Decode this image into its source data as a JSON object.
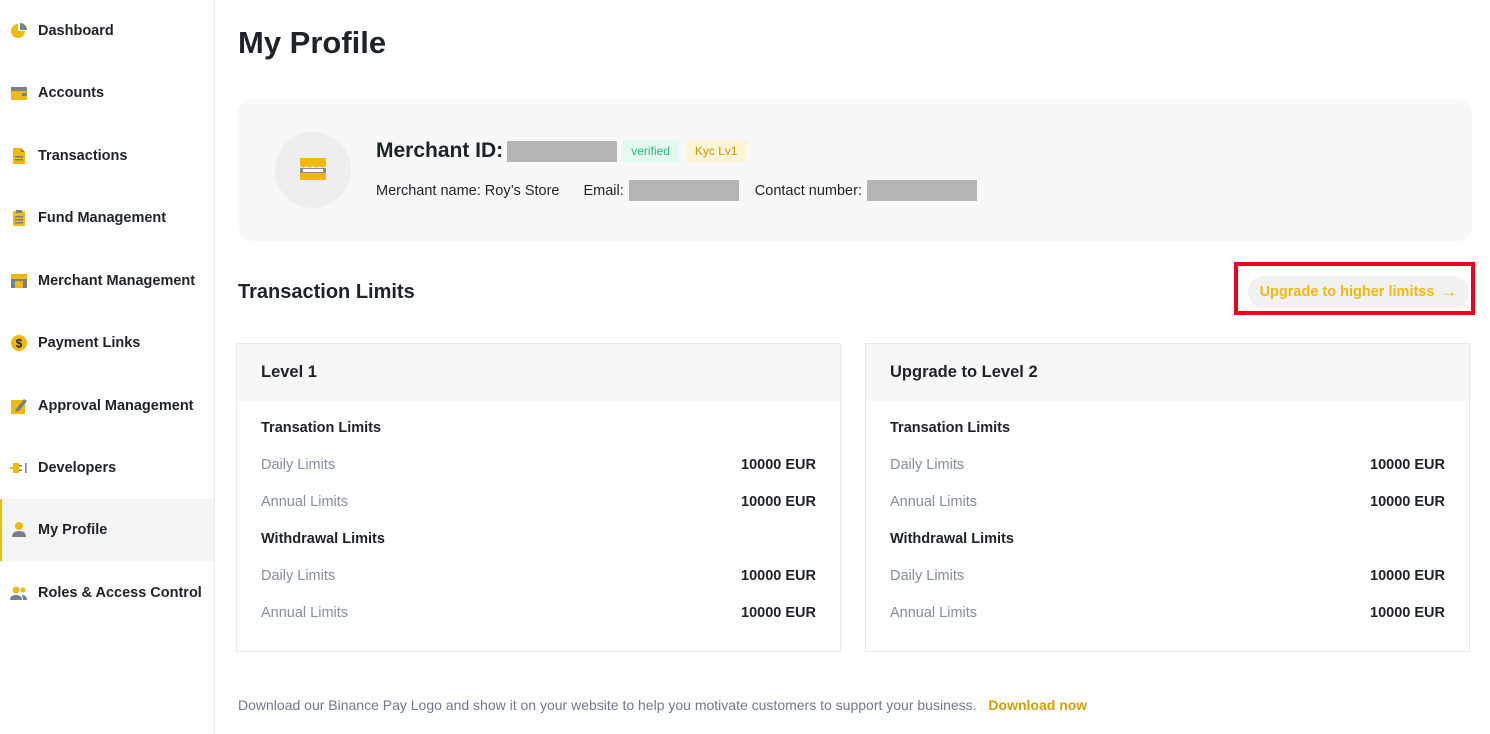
{
  "sidebar": {
    "items": [
      {
        "label": "Dashboard",
        "icon": "dashboard-pie-icon"
      },
      {
        "label": "Accounts",
        "icon": "wallet-icon"
      },
      {
        "label": "Transactions",
        "icon": "document-icon"
      },
      {
        "label": "Fund Management",
        "icon": "clipboard-icon"
      },
      {
        "label": "Merchant Management",
        "icon": "store-icon"
      },
      {
        "label": "Payment Links",
        "icon": "dollar-coin-icon"
      },
      {
        "label": "Approval Management",
        "icon": "edit-pencil-icon"
      },
      {
        "label": "Developers",
        "icon": "plug-icon"
      },
      {
        "label": "My Profile",
        "icon": "user-icon",
        "active": true
      },
      {
        "label": "Roles & Access Control",
        "icon": "users-icon"
      }
    ]
  },
  "page": {
    "title": "My Profile"
  },
  "profile": {
    "merchant_id_label": "Merchant ID:",
    "verified_badge": "verified",
    "kyc_badge": "Kyc Lv1",
    "merchant_name_text": "Merchant name: Roy’s Store",
    "email_label": "Email:",
    "contact_label": "Contact number:"
  },
  "limits": {
    "section_title": "Transaction Limits",
    "upgrade_button": "Upgrade to higher limitss",
    "upgrade_arrow": "→",
    "cards": [
      {
        "title": "Level 1",
        "groups": [
          {
            "title": "Transation Limits",
            "rows": [
              {
                "label": "Daily Limits",
                "value": "10000 EUR"
              },
              {
                "label": "Annual Limits",
                "value": "10000 EUR"
              }
            ]
          },
          {
            "title": "Withdrawal Limits",
            "rows": [
              {
                "label": "Daily Limits",
                "value": "10000 EUR"
              },
              {
                "label": "Annual Limits",
                "value": "10000 EUR"
              }
            ]
          }
        ]
      },
      {
        "title": "Upgrade to Level 2",
        "groups": [
          {
            "title": "Transation Limits",
            "rows": [
              {
                "label": "Daily Limits",
                "value": "10000 EUR"
              },
              {
                "label": "Annual Limits",
                "value": "10000 EUR"
              }
            ]
          },
          {
            "title": "Withdrawal Limits",
            "rows": [
              {
                "label": "Daily Limits",
                "value": "10000 EUR"
              },
              {
                "label": "Annual Limits",
                "value": "10000 EUR"
              }
            ]
          }
        ]
      }
    ]
  },
  "footer": {
    "text": "Download our Binance Pay Logo and show it on your website to help you motivate customers to support your business.",
    "link": "Download now"
  },
  "colors": {
    "accent": "#f0b90b",
    "highlight": "#e8001c",
    "verified": "#2eb27a",
    "kyc": "#c99400"
  }
}
